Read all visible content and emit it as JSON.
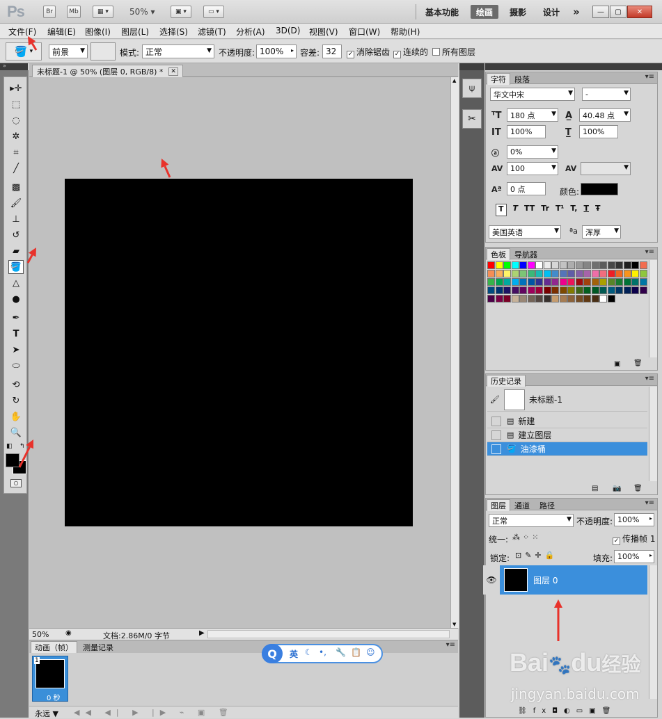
{
  "app": {
    "logo": "Ps",
    "bridge_button": "Br",
    "minibridge_button": "Mb",
    "zoom": "50%",
    "workspaces": [
      "基本功能",
      "绘画",
      "摄影",
      "设计"
    ],
    "more_workspaces": "»"
  },
  "menu": [
    "文件(F)",
    "编辑(E)",
    "图像(I)",
    "图层(L)",
    "选择(S)",
    "滤镜(T)",
    "分析(A)",
    "3D(D)",
    "视图(V)",
    "窗口(W)",
    "帮助(H)"
  ],
  "options": {
    "fill_source": "前景",
    "mode_label": "模式:",
    "mode_value": "正常",
    "opacity_label": "不透明度:",
    "opacity_value": "100%",
    "tolerance_label": "容差:",
    "tolerance_value": "32",
    "antialias_label": "消除锯齿",
    "contiguous_label": "连续的",
    "all_layers_label": "所有图层"
  },
  "document": {
    "tab_title": "未标题-1 @ 50% (图层 0, RGB/8) *",
    "canvas_color": "#000000",
    "status_zoom": "50%",
    "status_doc": "文档:2.86M/0 字节"
  },
  "animation": {
    "tabs": [
      "动画（帧）",
      "测量记录"
    ],
    "frame_number": "1",
    "frame_delay": "0 秒",
    "loop": "永远"
  },
  "ime": {
    "logo": "Q",
    "lang": "英"
  },
  "character": {
    "tabs": [
      "字符",
      "段落"
    ],
    "font_family": "华文中宋",
    "font_style": "-",
    "font_size": "180 点",
    "leading": "40.48 点",
    "vertical_scale": "100%",
    "horizontal_scale": "100%",
    "tsume": "0%",
    "tracking": "100",
    "baseline_shift": "0 点",
    "color_label": "颜色:",
    "color_value": "#000000",
    "language": "美国英语",
    "antialias_prefix": "ªa",
    "antialias": "浑厚",
    "style_buttons": [
      "T",
      "T",
      "TT",
      "Tr",
      "T¹",
      "T,",
      "T",
      "Ŧ"
    ]
  },
  "swatches": {
    "tabs": [
      "色板",
      "导航器"
    ]
  },
  "history": {
    "tabs": [
      "历史记录"
    ],
    "snapshot": "未标题-1",
    "items": [
      "新建",
      "建立图层",
      "油漆桶"
    ]
  },
  "layers": {
    "tabs": [
      "图层",
      "通道",
      "路径"
    ],
    "blend_mode": "正常",
    "opacity_label": "不透明度:",
    "opacity_value": "100%",
    "unify_label": "统一:",
    "propagate_label": "传播帧 1",
    "lock_label": "锁定:",
    "fill_label": "填充:",
    "fill_value": "100%",
    "layer_name": "图层 0"
  },
  "watermark": {
    "brand": "Bai",
    "brand2": "du",
    "brand_cn": "经验",
    "url": "jingyan.baidu.com"
  },
  "colors": {
    "accent": "#3b8fdc",
    "annotation_arrow": "#e8322b"
  }
}
